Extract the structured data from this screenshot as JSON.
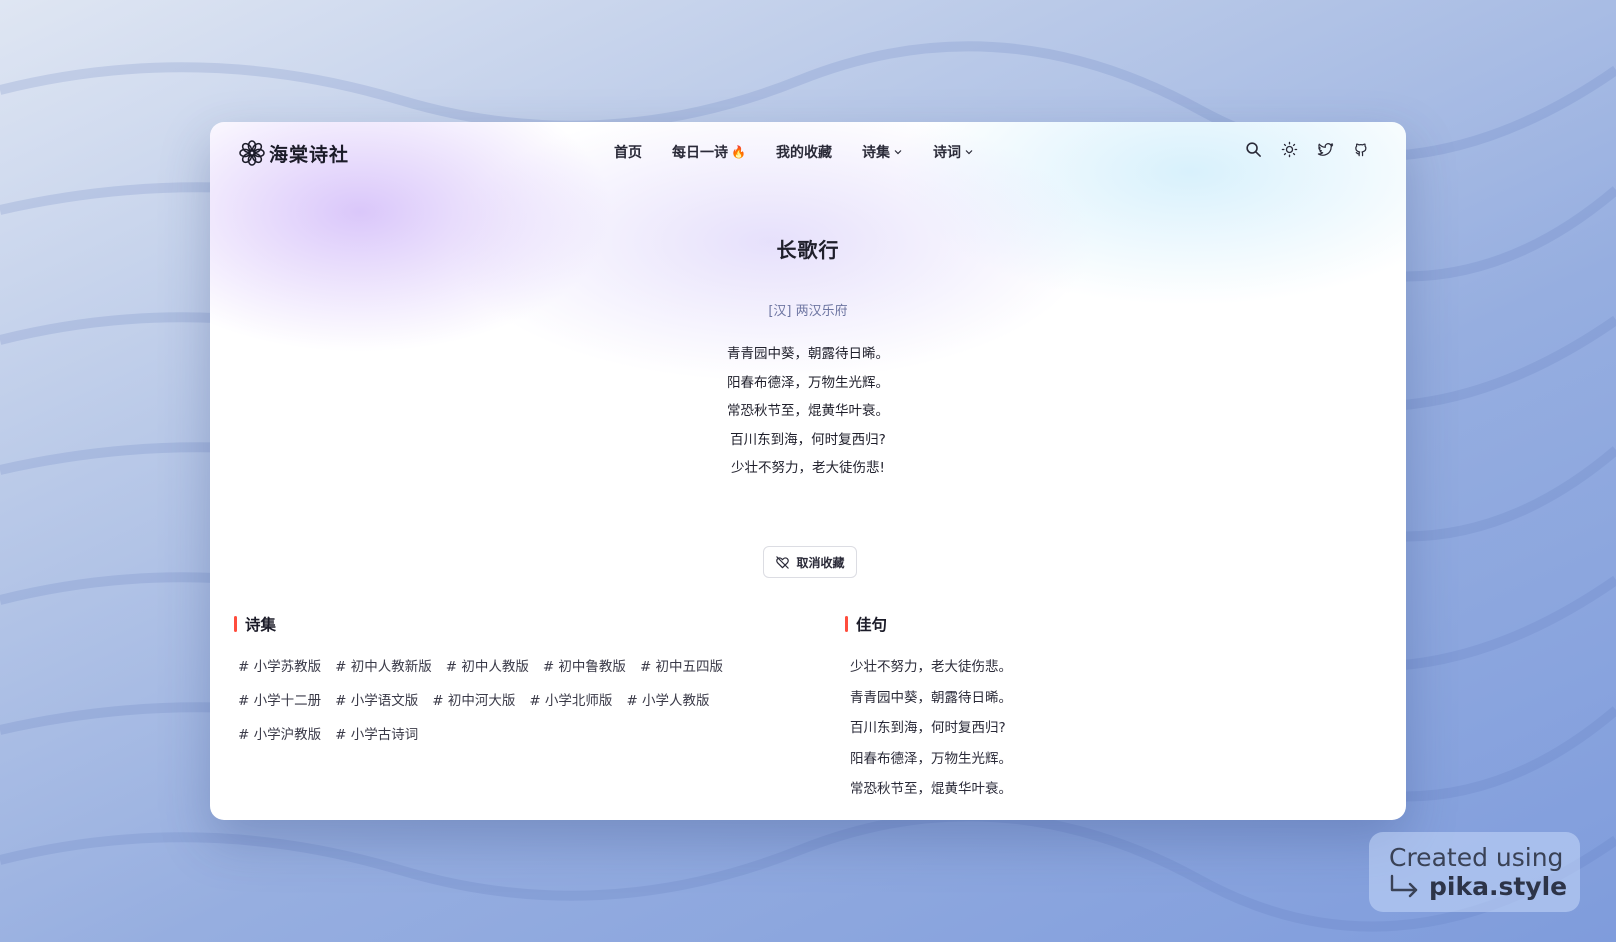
{
  "site": {
    "logo_text": "海棠诗社"
  },
  "nav": {
    "items": [
      {
        "label": "首页",
        "has_dropdown": false,
        "has_fire": false
      },
      {
        "label": "每日一诗",
        "has_dropdown": false,
        "has_fire": true
      },
      {
        "label": "我的收藏",
        "has_dropdown": false,
        "has_fire": false
      },
      {
        "label": "诗集",
        "has_dropdown": true,
        "has_fire": false
      },
      {
        "label": "诗词",
        "has_dropdown": true,
        "has_fire": false
      }
    ],
    "fire_icon": "🔥",
    "actions": [
      "search-icon",
      "sun-icon",
      "twitter-icon",
      "github-icon"
    ]
  },
  "poem": {
    "title": "长歌行",
    "author": "[汉] 两汉乐府",
    "lines": [
      "青青园中葵，朝露待日晞。",
      "阳春布德泽，万物生光辉。",
      "常恐秋节至，焜黄华叶衰。",
      "百川东到海，何时复西归?",
      "少壮不努力，老大徒伤悲!"
    ]
  },
  "unfavorite_button": {
    "label": "取消收藏"
  },
  "collections": {
    "title": "诗集",
    "tags": [
      "# 小学苏教版",
      "# 初中人教新版",
      "# 初中人教版",
      "# 初中鲁教版",
      "# 初中五四版",
      "# 小学十二册",
      "# 小学语文版",
      "# 初中河大版",
      "# 小学北师版",
      "# 小学人教版",
      "# 小学沪教版",
      "# 小学古诗词"
    ]
  },
  "quotes": {
    "title": "佳句",
    "items": [
      "少壮不努力，老大徒伤悲。",
      "青青园中葵，朝露待日晞。",
      "百川东到海，何时复西归?",
      "阳春布德泽，万物生光辉。",
      "常恐秋节至，焜黄华叶衰。"
    ]
  },
  "watermark": {
    "line1": "Created using",
    "line2": "pika.style"
  },
  "colors": {
    "accent_bar": "#ff4d3d",
    "author_text": "#6e76a2",
    "fire": "#ff6a1f"
  }
}
